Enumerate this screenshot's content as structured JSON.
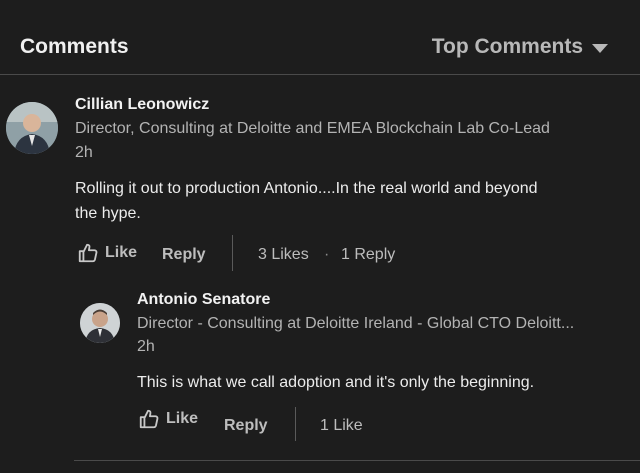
{
  "header": {
    "title": "Comments",
    "sort_label": "Top Comments"
  },
  "comment": {
    "author": "Cillian Leonowicz",
    "headline": "Director, Consulting at Deloitte and EMEA Blockchain Lab Co-Lead",
    "time": "2h",
    "body_line1": "Rolling it out to production Antonio....In the real world and beyond",
    "body_line2": "the hype.",
    "like_label": "Like",
    "reply_label": "Reply",
    "likes_count": "3 Likes",
    "separator": "·",
    "replies_count": "1 Reply"
  },
  "reply": {
    "author": "Antonio Senatore",
    "headline": "Director - Consulting at Deloitte Ireland - Global CTO Deloitt...",
    "time": "2h",
    "body": "This is what we call adoption and it's only the beginning.",
    "like_label": "Like",
    "reply_label": "Reply",
    "likes_count": "1 Like"
  },
  "icons": {
    "like": "thumbs-up-icon",
    "sort": "caret-down-icon"
  }
}
